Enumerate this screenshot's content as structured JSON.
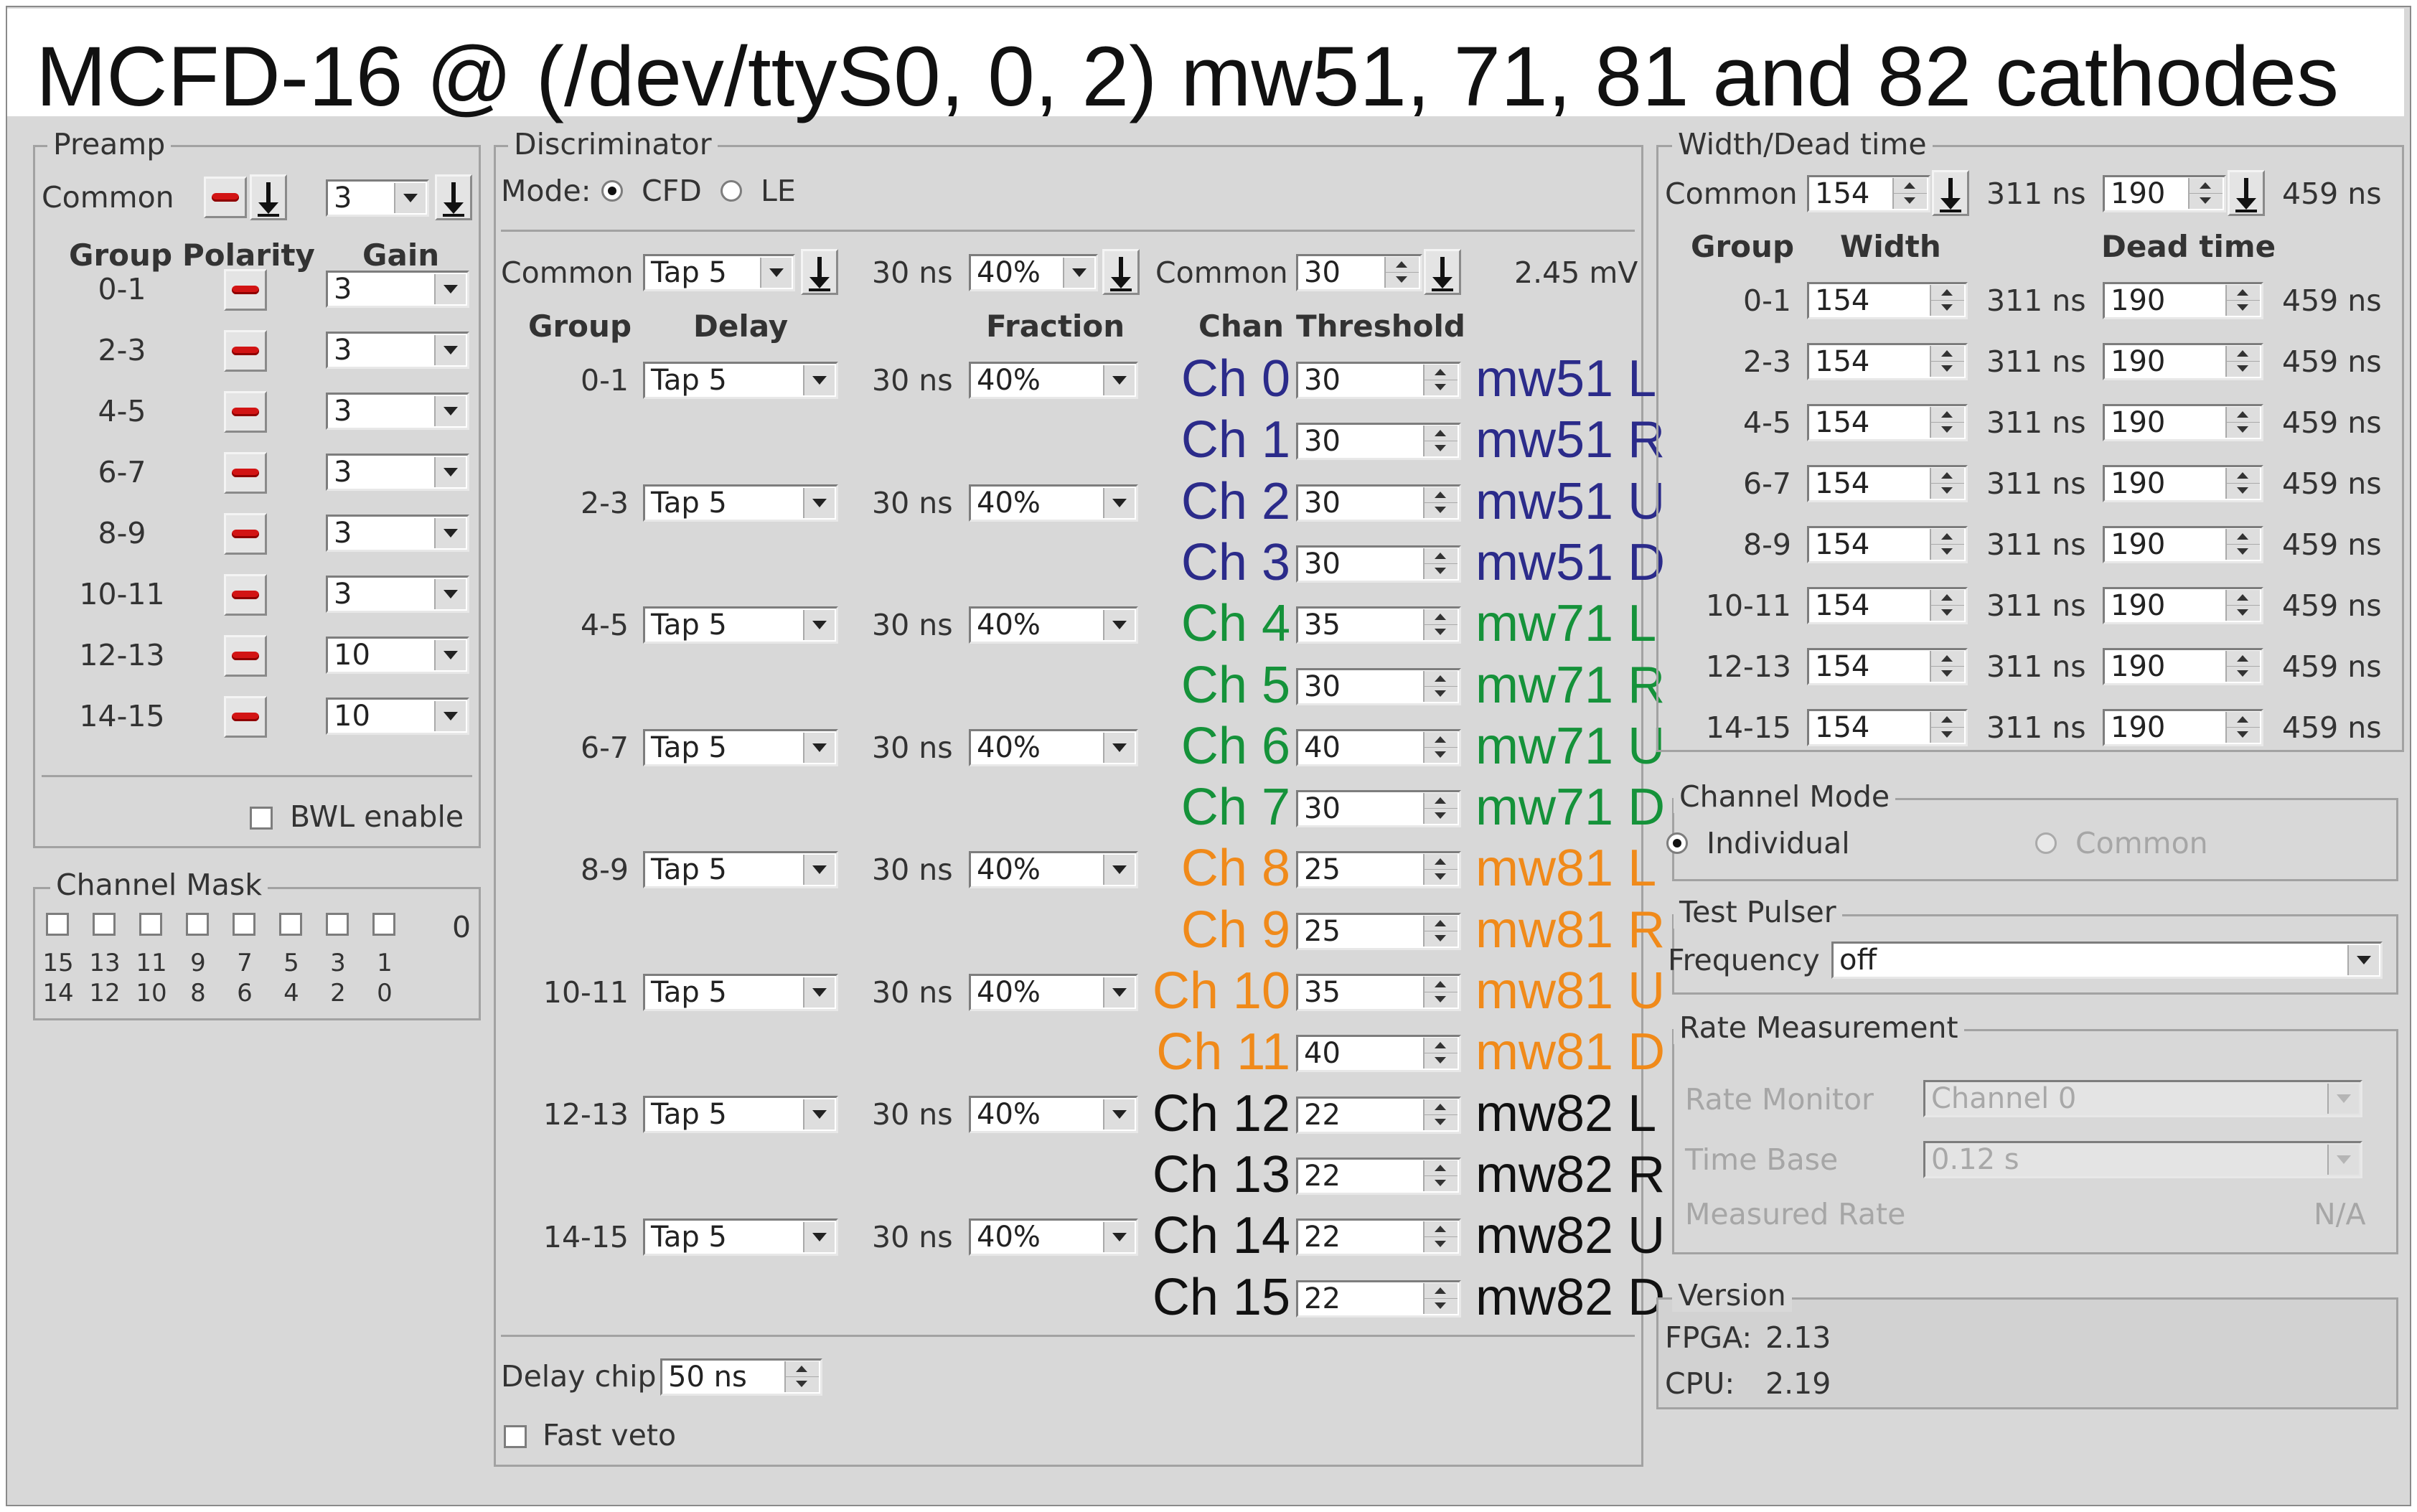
{
  "title": "MCFD-16 @ (/dev/ttyS0, 0, 2) mw51, 71, 81 and 82 cathodes",
  "colors": {
    "ch0_3": "#2b2b8a",
    "ch4_7": "#15923a",
    "ch8_11": "#f08a1a",
    "ch12_15": "#111111",
    "polarity": "#d21414"
  },
  "preamp": {
    "label": "Preamp",
    "common_label": "Common",
    "common_gain": "3",
    "headers": {
      "group": "Group",
      "polarity": "Polarity",
      "gain": "Gain"
    },
    "rows": [
      {
        "group": "0-1",
        "gain": "3"
      },
      {
        "group": "2-3",
        "gain": "3"
      },
      {
        "group": "4-5",
        "gain": "3"
      },
      {
        "group": "6-7",
        "gain": "3"
      },
      {
        "group": "8-9",
        "gain": "3"
      },
      {
        "group": "10-11",
        "gain": "3"
      },
      {
        "group": "12-13",
        "gain": "10"
      },
      {
        "group": "14-15",
        "gain": "10"
      }
    ],
    "bwl_label": "BWL enable"
  },
  "channel_mask": {
    "label": "Channel Mask",
    "value": "0",
    "top": [
      "15",
      "13",
      "11",
      "9",
      "7",
      "5",
      "3",
      "1"
    ],
    "bottom": [
      "14",
      "12",
      "10",
      "8",
      "6",
      "4",
      "2",
      "0"
    ]
  },
  "discriminator": {
    "label": "Discriminator",
    "mode_label": "Mode:",
    "mode_cfd": "CFD",
    "mode_le": "LE",
    "common_label": "Common",
    "common_delay": "Tap 5",
    "common_delay_ns": "30 ns",
    "common_fraction": "40%",
    "common_thr_label": "Common",
    "common_threshold": "30",
    "common_threshold_mv": "2.45 mV",
    "headers": {
      "group": "Group",
      "delay": "Delay",
      "fraction": "Fraction",
      "chan": "Chan",
      "threshold": "Threshold"
    },
    "groups": [
      {
        "group": "0-1",
        "delay": "Tap 5",
        "ns": "30 ns",
        "fraction": "40%"
      },
      {
        "group": "2-3",
        "delay": "Tap 5",
        "ns": "30 ns",
        "fraction": "40%"
      },
      {
        "group": "4-5",
        "delay": "Tap 5",
        "ns": "30 ns",
        "fraction": "40%"
      },
      {
        "group": "6-7",
        "delay": "Tap 5",
        "ns": "30 ns",
        "fraction": "40%"
      },
      {
        "group": "8-9",
        "delay": "Tap 5",
        "ns": "30 ns",
        "fraction": "40%"
      },
      {
        "group": "10-11",
        "delay": "Tap 5",
        "ns": "30 ns",
        "fraction": "40%"
      },
      {
        "group": "12-13",
        "delay": "Tap 5",
        "ns": "30 ns",
        "fraction": "40%"
      },
      {
        "group": "14-15",
        "delay": "Tap 5",
        "ns": "30 ns",
        "fraction": "40%"
      }
    ],
    "channels": [
      {
        "chan": "Ch 0",
        "threshold": "30",
        "name": "mw51 L"
      },
      {
        "chan": "Ch 1",
        "threshold": "30",
        "name": "mw51 R"
      },
      {
        "chan": "Ch 2",
        "threshold": "30",
        "name": "mw51 U"
      },
      {
        "chan": "Ch 3",
        "threshold": "30",
        "name": "mw51 D"
      },
      {
        "chan": "Ch 4",
        "threshold": "35",
        "name": "mw71 L"
      },
      {
        "chan": "Ch 5",
        "threshold": "30",
        "name": "mw71 R"
      },
      {
        "chan": "Ch 6",
        "threshold": "40",
        "name": "mw71 U"
      },
      {
        "chan": "Ch 7",
        "threshold": "30",
        "name": "mw71 D"
      },
      {
        "chan": "Ch 8",
        "threshold": "25",
        "name": "mw81 L"
      },
      {
        "chan": "Ch 9",
        "threshold": "25",
        "name": "mw81 R"
      },
      {
        "chan": "Ch 10",
        "threshold": "35",
        "name": "mw81 U"
      },
      {
        "chan": "Ch 11",
        "threshold": "40",
        "name": "mw81 D"
      },
      {
        "chan": "Ch 12",
        "threshold": "22",
        "name": "mw82 L"
      },
      {
        "chan": "Ch 13",
        "threshold": "22",
        "name": "mw82 R"
      },
      {
        "chan": "Ch 14",
        "threshold": "22",
        "name": "mw82 U"
      },
      {
        "chan": "Ch 15",
        "threshold": "22",
        "name": "mw82 D"
      }
    ],
    "delay_chip_label": "Delay chip",
    "delay_chip_value": "50 ns",
    "fast_veto_label": "Fast veto"
  },
  "width_dead": {
    "label": "Width/Dead time",
    "common_label": "Common",
    "common_width": "154",
    "common_width_ns": "311 ns",
    "common_dead": "190",
    "common_dead_ns": "459 ns",
    "headers": {
      "group": "Group",
      "width": "Width",
      "dead": "Dead time"
    },
    "rows": [
      {
        "group": "0-1",
        "width": "154",
        "width_ns": "311 ns",
        "dead": "190",
        "dead_ns": "459 ns"
      },
      {
        "group": "2-3",
        "width": "154",
        "width_ns": "311 ns",
        "dead": "190",
        "dead_ns": "459 ns"
      },
      {
        "group": "4-5",
        "width": "154",
        "width_ns": "311 ns",
        "dead": "190",
        "dead_ns": "459 ns"
      },
      {
        "group": "6-7",
        "width": "154",
        "width_ns": "311 ns",
        "dead": "190",
        "dead_ns": "459 ns"
      },
      {
        "group": "8-9",
        "width": "154",
        "width_ns": "311 ns",
        "dead": "190",
        "dead_ns": "459 ns"
      },
      {
        "group": "10-11",
        "width": "154",
        "width_ns": "311 ns",
        "dead": "190",
        "dead_ns": "459 ns"
      },
      {
        "group": "12-13",
        "width": "154",
        "width_ns": "311 ns",
        "dead": "190",
        "dead_ns": "459 ns"
      },
      {
        "group": "14-15",
        "width": "154",
        "width_ns": "311 ns",
        "dead": "190",
        "dead_ns": "459 ns"
      }
    ]
  },
  "channel_mode": {
    "label": "Channel Mode",
    "individual": "Individual",
    "common": "Common"
  },
  "test_pulser": {
    "label": "Test Pulser",
    "frequency_label": "Frequency",
    "frequency_value": "off"
  },
  "rate": {
    "label": "Rate Measurement",
    "monitor_label": "Rate Monitor",
    "monitor_value": "Channel 0",
    "timebase_label": "Time Base",
    "timebase_value": "0.12 s",
    "measured_label": "Measured Rate",
    "measured_value": "N/A"
  },
  "version": {
    "label": "Version",
    "fpga_label": "FPGA:",
    "fpga_value": "2.13",
    "cpu_label": "CPU:",
    "cpu_value": "2.19"
  }
}
